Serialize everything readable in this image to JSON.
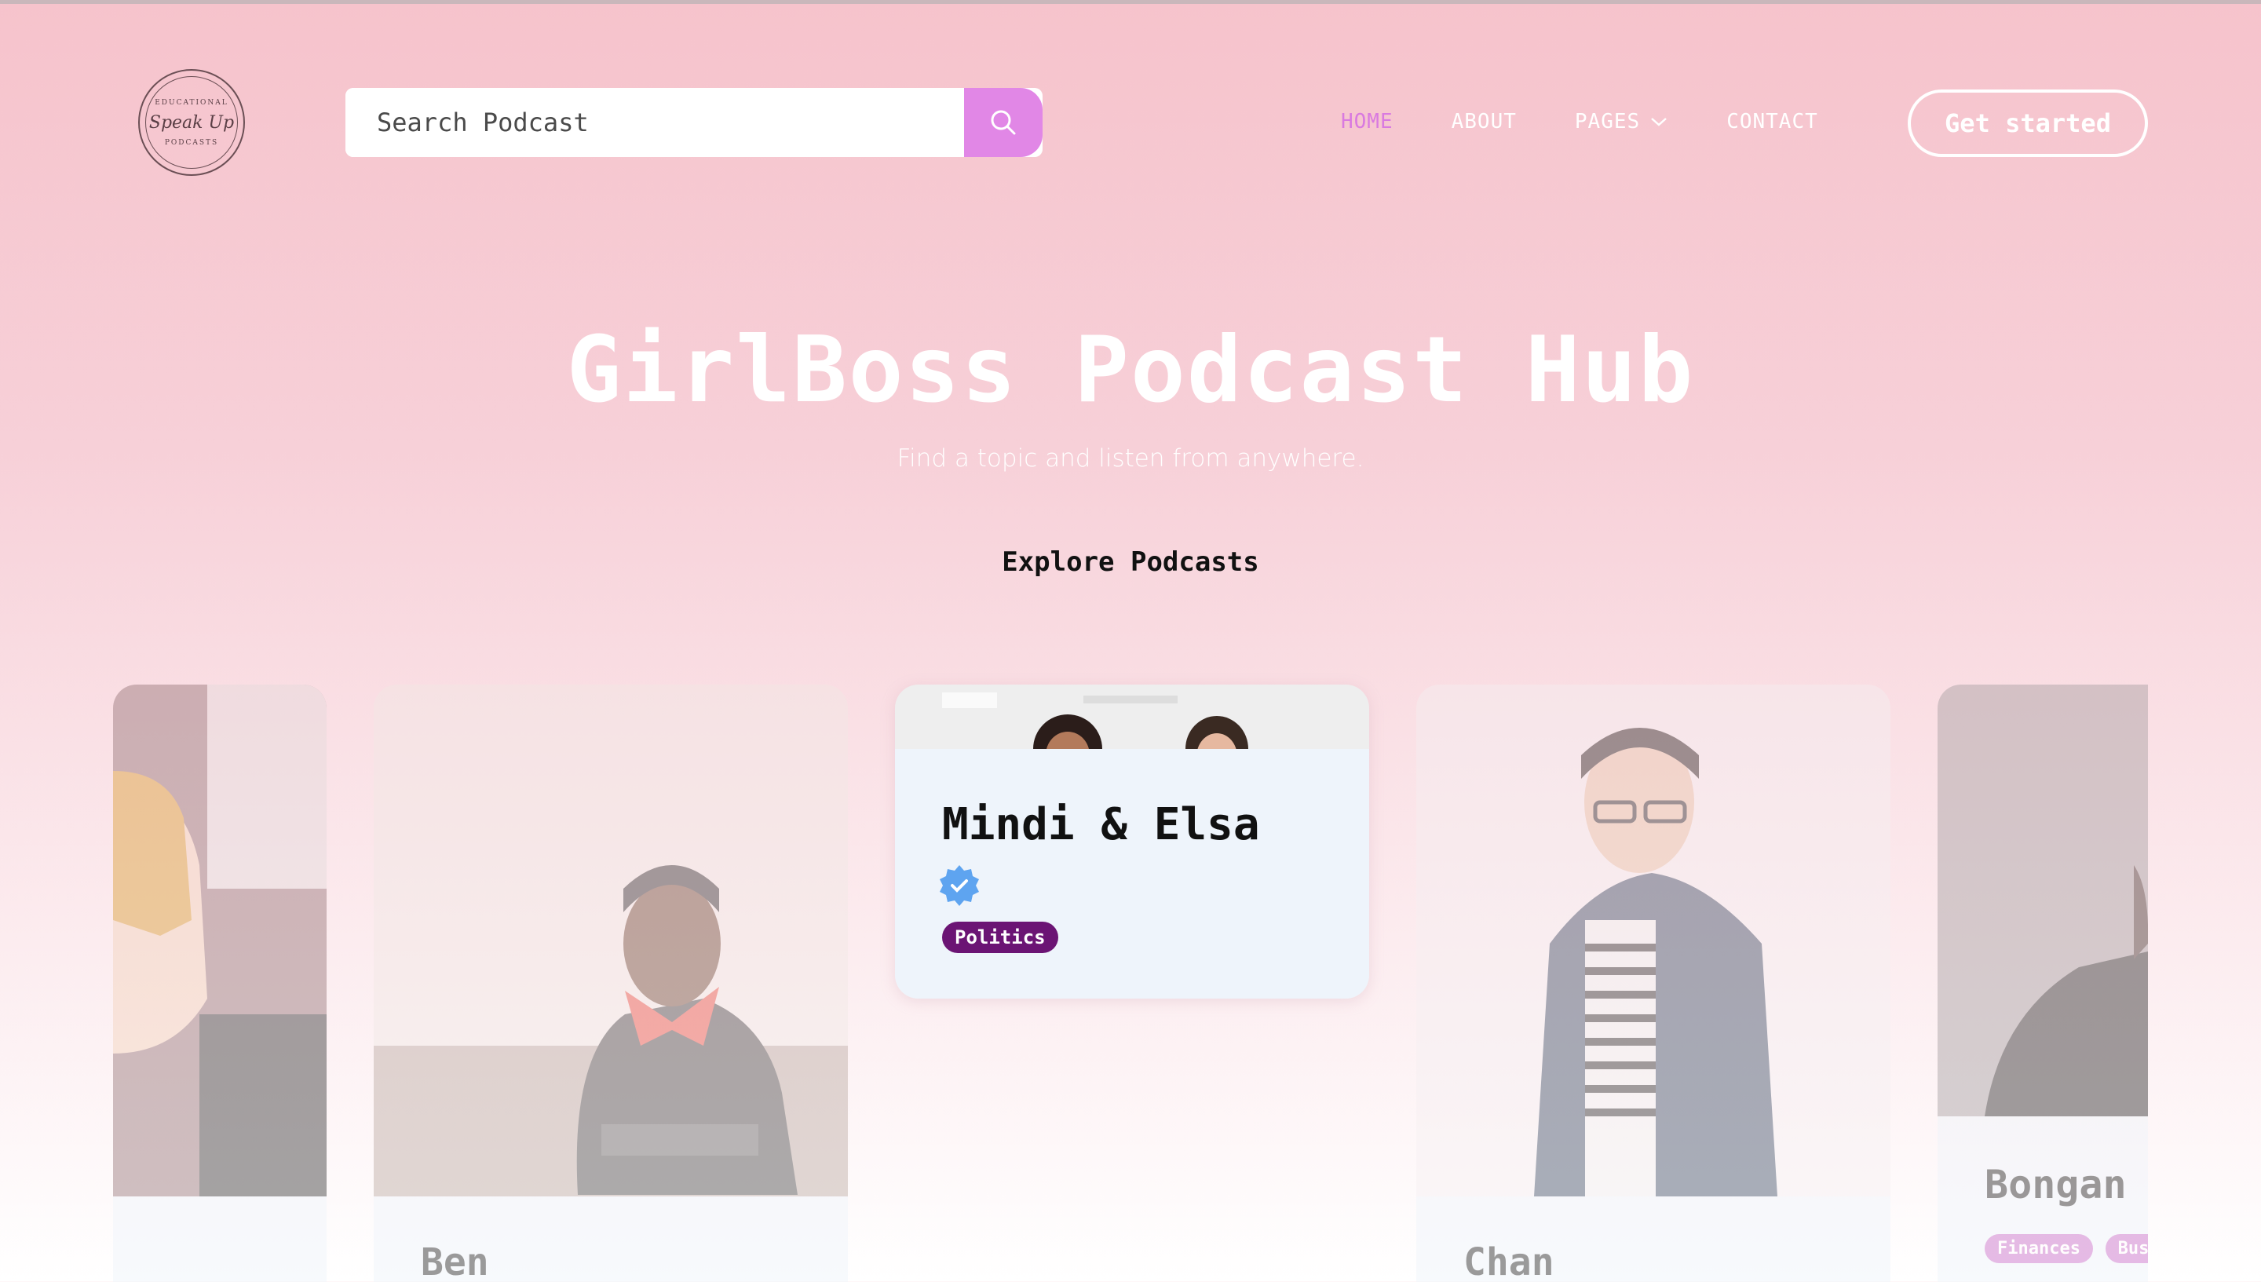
{
  "header": {
    "logo": {
      "top": "EDUCATIONAL",
      "script": "Speak Up",
      "bottom": "PODCASTS"
    },
    "search": {
      "placeholder": "Search Podcast",
      "icon": "search-icon"
    },
    "nav": [
      {
        "label": "HOME",
        "active": true
      },
      {
        "label": "ABOUT",
        "active": false
      },
      {
        "label": "PAGES",
        "active": false,
        "dropdown": true
      },
      {
        "label": "CONTACT",
        "active": false
      }
    ],
    "cta_label": "Get started"
  },
  "hero": {
    "title": "GirlBoss Podcast Hub",
    "subtitle": "Find a topic and listen from anywhere.",
    "section_label": "Explore Podcasts"
  },
  "cards": {
    "ben": {
      "name": "Ben"
    },
    "mindi": {
      "name": "Mindi & Elsa",
      "verified": true,
      "tags": [
        "Politics"
      ]
    },
    "chan": {
      "name": "Chan"
    },
    "bongani": {
      "name": "Bongan",
      "tags": [
        "Finances",
        "Bus"
      ]
    }
  },
  "colors": {
    "accent": "#e187e6",
    "nav_active": "#d97ae0",
    "tag_politics": "#6b1474",
    "tag_finance": "#c25fc4",
    "verified": "#5ea4f0"
  }
}
